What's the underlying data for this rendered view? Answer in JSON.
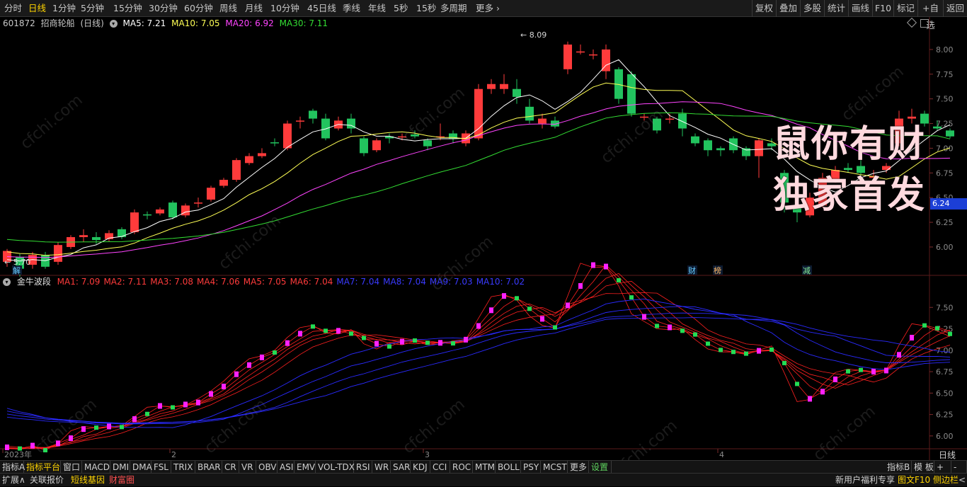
{
  "topbar": {
    "periods": [
      "分时",
      "日线",
      "1分钟",
      "5分钟",
      "15分钟",
      "30分钟",
      "60分钟",
      "周线",
      "月线",
      "10分钟",
      "45日线",
      "季线",
      "年线",
      "5秒",
      "15秒",
      "多周期",
      "更多"
    ],
    "active_period": "日线",
    "right_buttons": [
      "复权",
      "叠加",
      "多股",
      "统计",
      "画线",
      "F10",
      "标记",
      "+自选",
      "返回"
    ]
  },
  "stock": {
    "code": "601872",
    "name": "招商轮船",
    "period": "(日线)",
    "ma5": "MA5: 7.21",
    "ma10": "MA10: 7.05",
    "ma20": "MA20: 6.92",
    "ma30": "MA30: 7.11"
  },
  "main_chart": {
    "price_axis": [
      "8.00",
      "7.75",
      "7.50",
      "7.25",
      "7.00",
      "6.75",
      "6.50",
      "6.25",
      "6.00"
    ],
    "high_label": "8.09",
    "low_label": "5.70",
    "current_price": "6.24",
    "event_markers": [
      "解",
      "财",
      "榜",
      "减"
    ]
  },
  "indicator": {
    "name": "金牛波段",
    "values": [
      {
        "label": "MA1: 7.09",
        "color": "#ff3b3b"
      },
      {
        "label": "MA2: 7.11",
        "color": "#ff3b3b"
      },
      {
        "label": "MA3: 7.08",
        "color": "#ff3b3b"
      },
      {
        "label": "MA4: 7.06",
        "color": "#ff3b3b"
      },
      {
        "label": "MA5: 7.05",
        "color": "#ff3b3b"
      },
      {
        "label": "MA6: 7.04",
        "color": "#ff3b3b"
      },
      {
        "label": "MA7: 7.04",
        "color": "#3a3aff"
      },
      {
        "label": "MA8: 7.04",
        "color": "#3a3aff"
      },
      {
        "label": "MA9: 7.03",
        "color": "#3a3aff"
      },
      {
        "label": "MA10: 7.02",
        "color": "#3a3aff"
      }
    ],
    "axis": [
      "7.50",
      "7.25",
      "7.00",
      "6.75",
      "6.50",
      "6.25",
      "6.00"
    ]
  },
  "time_axis": {
    "labels": [
      "2023年",
      "2",
      "3",
      "4"
    ],
    "right_label": "日线"
  },
  "tabs": {
    "items": [
      "指标A",
      "指标平台",
      "窗口",
      "MACD",
      "DMI",
      "DMA",
      "FSL",
      "TRIX",
      "BRAR",
      "CR",
      "VR",
      "OBV",
      "ASI",
      "EMV",
      "VOL-TDX",
      "RSI",
      "WR",
      "SAR",
      "KDJ",
      "CCI",
      "ROC",
      "MTM",
      "BOLL",
      "PSY",
      "MCST",
      "更多",
      "设置"
    ],
    "right_items": [
      "指标B",
      "模 板",
      "+",
      "-"
    ]
  },
  "bottom": {
    "items": [
      "扩展∧",
      "关联报价",
      "短线基因",
      "财富圈"
    ],
    "right_items": [
      "新用户福利专享",
      "图文F10",
      "侧边栏",
      "<"
    ]
  },
  "promo": {
    "line1": "鼠你有财",
    "line2": "独家首发"
  },
  "watermark": "cfchi.com",
  "colors": {
    "up": "#ff3b3b",
    "down": "#22c35e",
    "ma5": "#ffffff",
    "ma10": "#ffff55",
    "ma20": "#ff44ff",
    "ma30": "#33dd33",
    "accent": "#ffd400"
  }
}
